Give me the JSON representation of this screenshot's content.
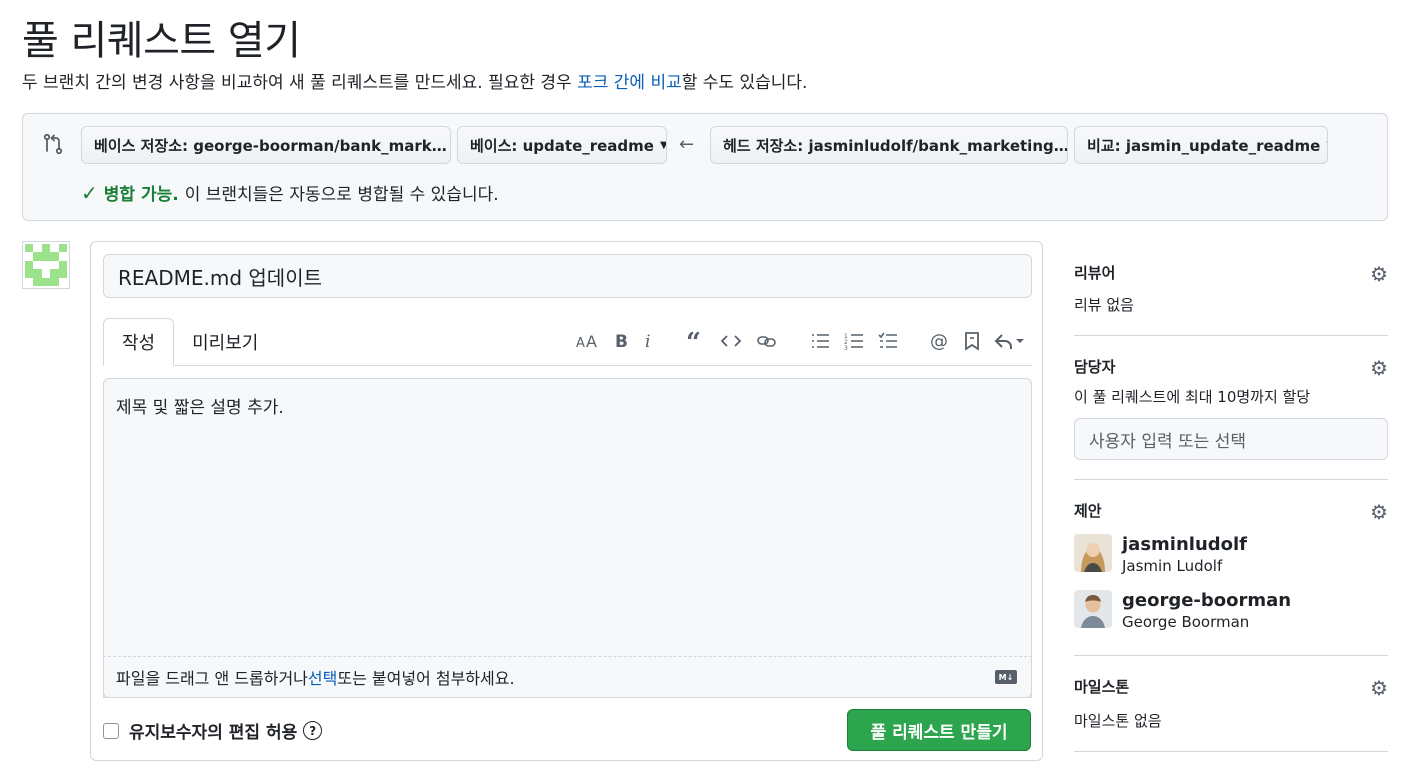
{
  "page": {
    "title": "풀 리퀘스트 열기",
    "description_before": "두 브랜치 간의 변경 사항을 비교하여 새 풀 리퀘스트를 만드세요. 필요한 경우 ",
    "description_link": "포크 간에 비교",
    "description_after": "할 수도 있습니다."
  },
  "compare": {
    "base_repo": "베이스 저장소: george-boorman/bank_mark…",
    "base_branch": "베이스: update_readme",
    "head_repo": "헤드 저장소: jasminludolf/bank_marketing…",
    "compare_branch": "비교: jasmin_update_readme",
    "arrow": "←",
    "merge_ok": "병합 가능.",
    "merge_text": "이 브랜치들은 자동으로 병합될 수 있습니다."
  },
  "composer": {
    "title_value": "README.md 업데이트",
    "tab_write": "작성",
    "tab_preview": "미리보기",
    "body_value": "제목 및 짧은 설명 추가.",
    "attach_before": "파일을 드래그 앤 드롭하거나 ",
    "attach_link": "선택",
    "attach_after": " 또는 붙여넣어 첨부하세요.",
    "markdown_badge": "M↓",
    "allow_edits": "유지보수자의 편집 허용",
    "create_button": "풀 리퀘스트 만들기",
    "toolbar_icons": [
      "heading-icon",
      "bold-icon",
      "italic-icon",
      "quote-icon",
      "code-icon",
      "link-icon",
      "unordered-list-icon",
      "ordered-list-icon",
      "task-list-icon",
      "mention-icon",
      "reference-icon",
      "reply-icon"
    ]
  },
  "sidebar": {
    "reviewers_title": "리뷰어",
    "reviewers_value": "리뷰 없음",
    "assignees_title": "담당자",
    "assignees_value": "이 풀 리퀘스트에 최대 10명까지 할당",
    "assignees_placeholder": "사용자 입력 또는 선택",
    "suggestions_title": "제안",
    "suggestions": [
      {
        "login": "jasminludolf",
        "name": "Jasmin Ludolf"
      },
      {
        "login": "george-boorman",
        "name": "George Boorman"
      }
    ],
    "milestone_title": "마일스톤",
    "milestone_value": "마일스톤 없음"
  },
  "colors": {
    "accent_link": "#0a5eb8",
    "success_green": "#1a7f37",
    "button_green": "#2da44e",
    "border": "#d0d7de"
  }
}
